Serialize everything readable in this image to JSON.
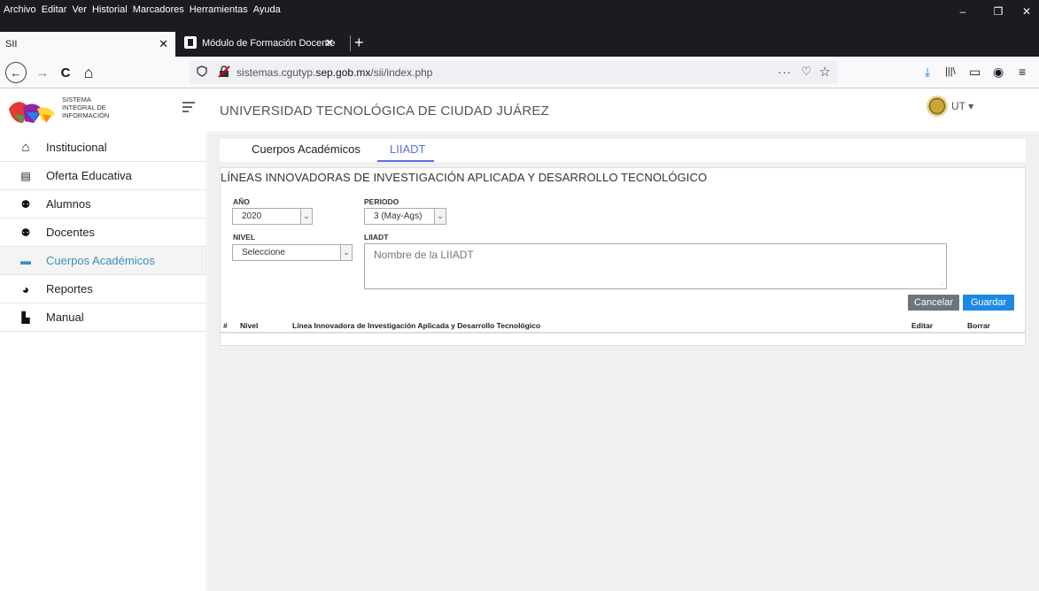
{
  "browser": {
    "menu": [
      "Archivo",
      "Editar",
      "Ver",
      "Historial",
      "Marcadores",
      "Herramientas",
      "Ayuda"
    ],
    "window_controls": [
      "–",
      "❐",
      "✕"
    ],
    "tabs": [
      {
        "title": "SII",
        "close": "✕"
      },
      {
        "title": "Módulo de Formación Docente",
        "close": "✕"
      }
    ],
    "new_tab": "+",
    "url_prefix": "sistemas.cgutyp.",
    "url_domain": "sep.gob.mx",
    "url_path": "/sii/index.php",
    "nav_back": "←",
    "nav_forward": "→",
    "nav_reload": "C",
    "nav_home": "⌂",
    "more_label": "···",
    "pocket_label": "♡",
    "star_label": "☆",
    "toolbar_icons": [
      "⤓",
      "|||\\",
      "▭",
      "◉",
      "≡"
    ]
  },
  "app": {
    "logo_lines": [
      "SISTEMA",
      "INTEGRAL DE",
      "INFORMACIÓN"
    ],
    "university": "UNIVERSIDAD TECNOLÓGICA DE CIUDAD JUÁREZ",
    "user": "UT ▾",
    "sidebar": [
      {
        "label": "Institucional",
        "icon": "home-icon",
        "glyph": "⌂"
      },
      {
        "label": "Oferta Educativa",
        "icon": "book-icon",
        "glyph": "▤"
      },
      {
        "label": "Alumnos",
        "icon": "users-icon",
        "glyph": "⚉"
      },
      {
        "label": "Docentes",
        "icon": "users-icon",
        "glyph": "⚉"
      },
      {
        "label": "Cuerpos Académicos",
        "icon": "folder-icon",
        "glyph": "▬",
        "active": true
      },
      {
        "label": "Reportes",
        "icon": "pie-chart-icon",
        "glyph": "◕"
      },
      {
        "label": "Manual",
        "icon": "pdf-icon",
        "glyph": "▙"
      }
    ],
    "content_tabs": [
      {
        "label": "Cuerpos Académicos"
      },
      {
        "label": "LIIADT",
        "active": true
      }
    ],
    "panel": {
      "title": "LÍNEAS INNOVADORAS DE INVESTIGACIÓN APLICADA Y DESARROLLO TECNOLÓGICO",
      "anio_label": "AÑO",
      "anio_value": "2020",
      "periodo_label": "PERIODO",
      "periodo_value": "3 (May-Ags)",
      "nivel_label": "NIVEL",
      "nivel_value": "Seleccione",
      "liiadt_label": "LIIADT",
      "liiadt_placeholder": "Nombre de la LIIADT",
      "cancel": "Cancelar",
      "save": "Guardar"
    },
    "table_headers": [
      "#",
      "Nivel",
      "Línea Innovadora de Investigación Aplicada y Desarrollo Tecnológico",
      "Editar",
      "Borrar"
    ],
    "colors": {
      "accent": "#3c8dbc",
      "tab_active": "#5b6ee8",
      "save": "#1e88e5",
      "cancel": "#6c757d"
    }
  }
}
